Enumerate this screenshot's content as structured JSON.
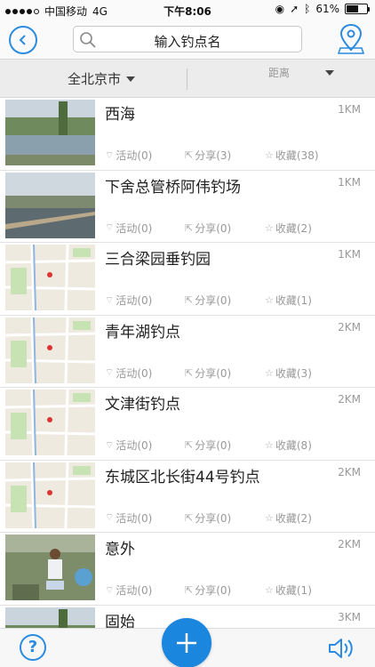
{
  "status_bar": {
    "carrier": "中国移动",
    "network": "4G",
    "time": "下午8:06",
    "battery": "61%",
    "battery_level": 0.61
  },
  "nav": {
    "search_placeholder": "输入钓点名",
    "icons": {
      "back": "back-arrow-icon",
      "search": "search-icon",
      "location": "location-pin-icon"
    }
  },
  "filters": {
    "city": "全北京市",
    "sort": "距离"
  },
  "spots": [
    {
      "name": "西海",
      "distance": "1KM",
      "activity": "活动(0)",
      "share": "分享(3)",
      "favorite": "收藏(38)",
      "thumb": "lake"
    },
    {
      "name": "下舍总管桥阿伟钓场",
      "distance": "1KM",
      "activity": "活动(0)",
      "share": "分享(0)",
      "favorite": "收藏(2)",
      "thumb": "pier"
    },
    {
      "name": "三合梁园垂钓园",
      "distance": "1KM",
      "activity": "活动(0)",
      "share": "分享(0)",
      "favorite": "收藏(1)",
      "thumb": "map"
    },
    {
      "name": "青年湖钓点",
      "distance": "2KM",
      "activity": "活动(0)",
      "share": "分享(0)",
      "favorite": "收藏(3)",
      "thumb": "map"
    },
    {
      "name": "文津街钓点",
      "distance": "2KM",
      "activity": "活动(0)",
      "share": "分享(0)",
      "favorite": "收藏(8)",
      "thumb": "map"
    },
    {
      "name": "东城区北长街44号钓点",
      "distance": "2KM",
      "activity": "活动(0)",
      "share": "分享(0)",
      "favorite": "收藏(2)",
      "thumb": "map"
    },
    {
      "name": "意外",
      "distance": "2KM",
      "activity": "活动(0)",
      "share": "分享(0)",
      "favorite": "收藏(1)",
      "thumb": "people"
    },
    {
      "name": "固始",
      "distance": "3KM",
      "activity": "",
      "share": "",
      "favorite": "",
      "thumb": "lake"
    }
  ],
  "bottom": {
    "help_label": "?",
    "icons": {
      "help": "help-icon",
      "add": "plus-icon",
      "speaker": "speaker-icon"
    }
  },
  "colors": {
    "accent": "#1a86dd"
  }
}
